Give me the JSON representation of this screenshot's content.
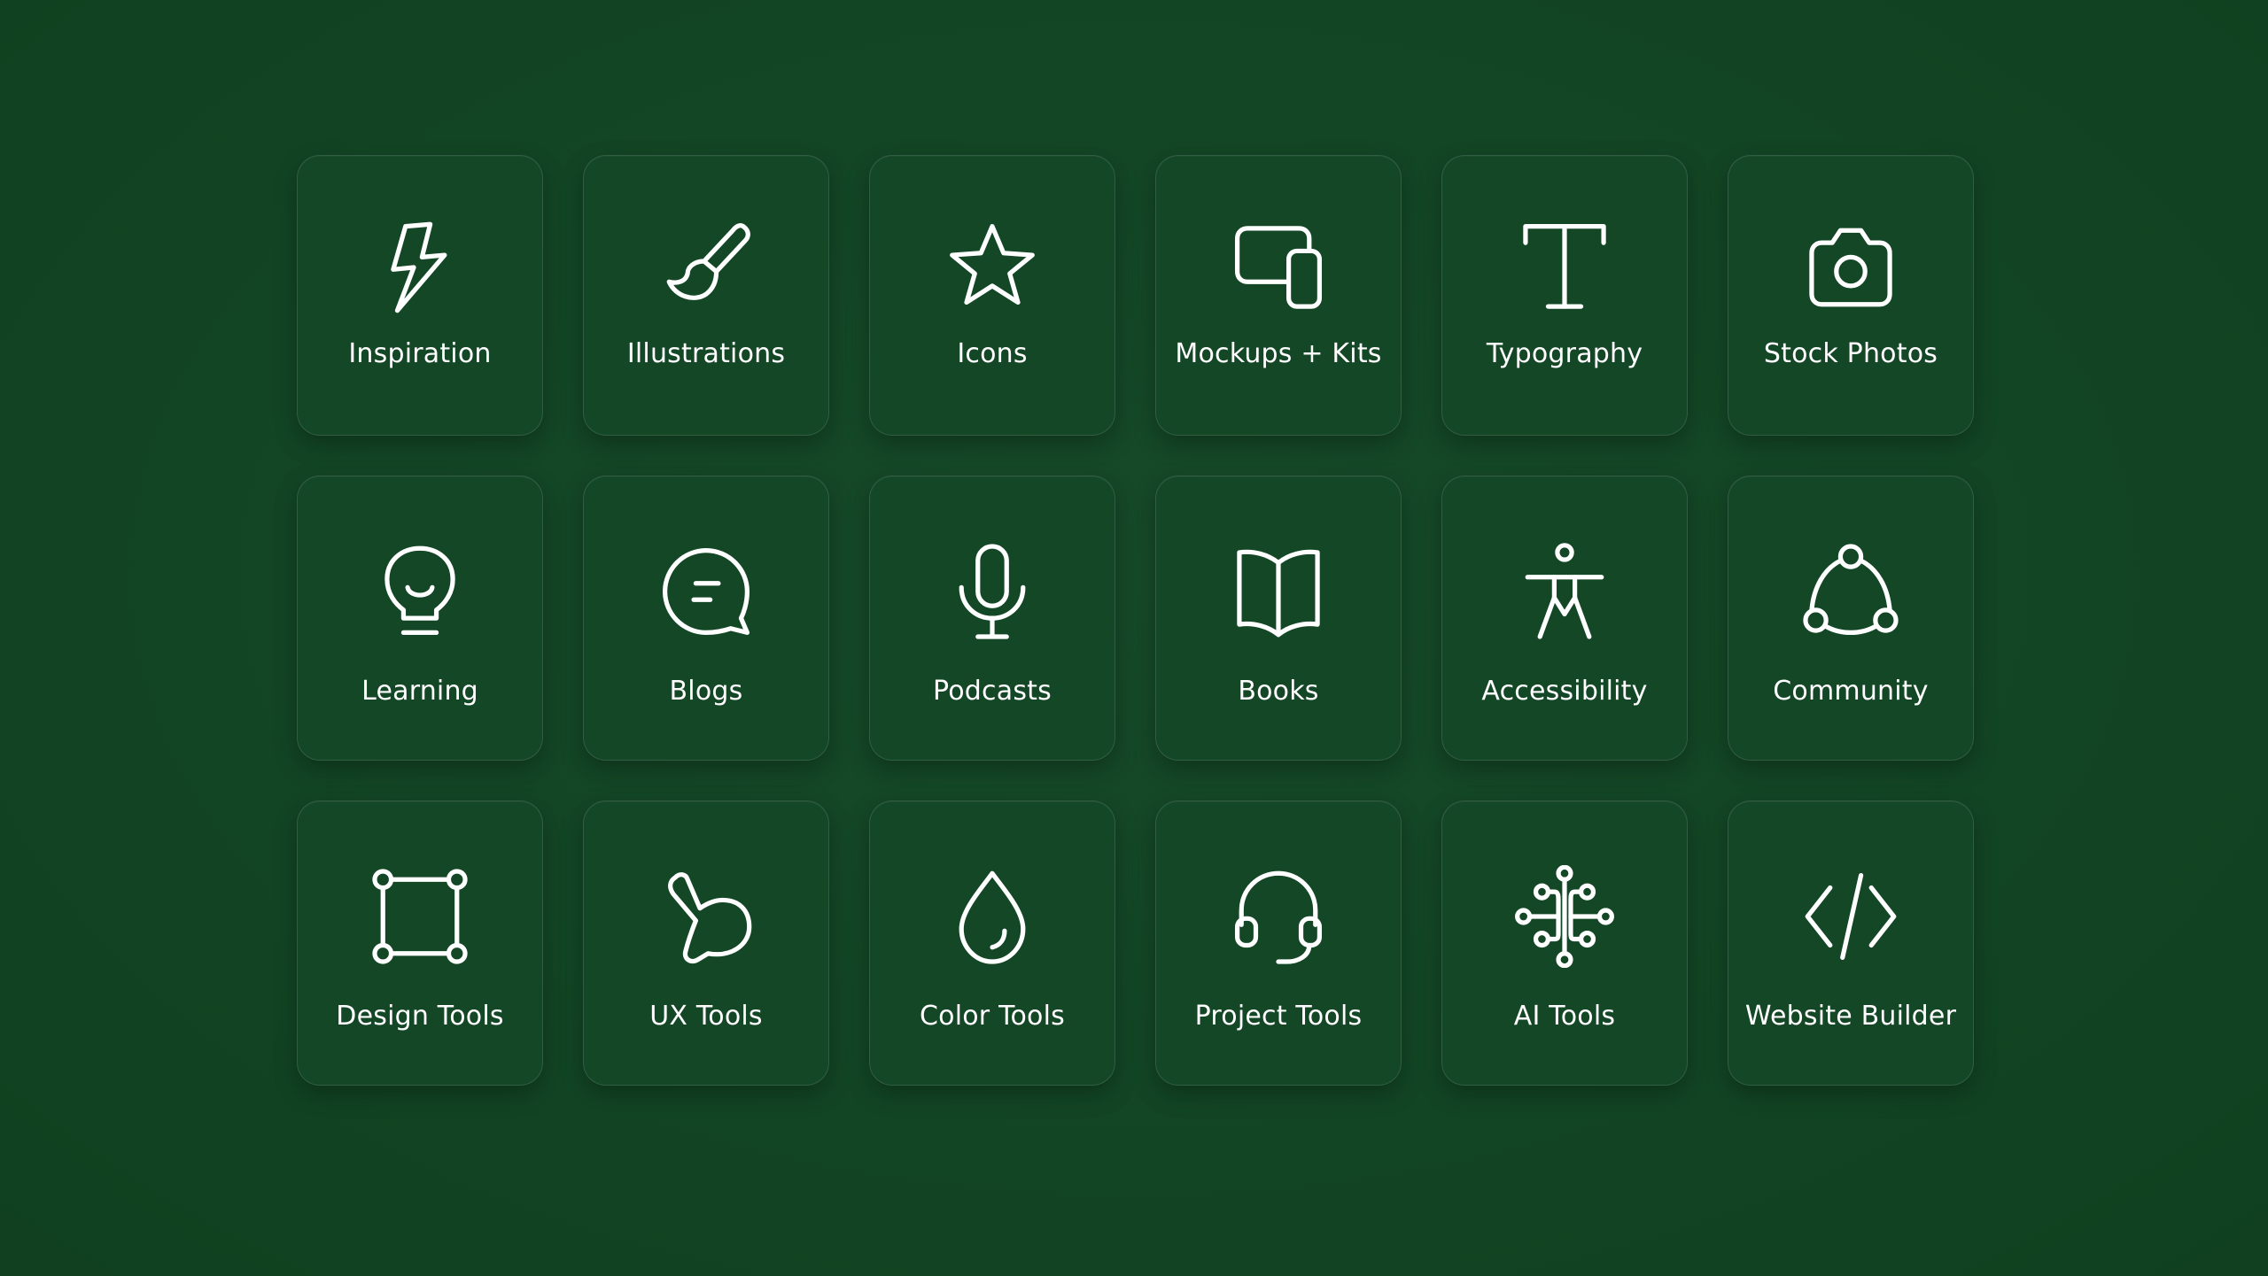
{
  "tiles": [
    {
      "label": "Inspiration",
      "icon": "lightning-bolt-icon"
    },
    {
      "label": "Illustrations",
      "icon": "paint-brush-icon"
    },
    {
      "label": "Icons",
      "icon": "star-icon"
    },
    {
      "label": "Mockups + Kits",
      "icon": "devices-icon"
    },
    {
      "label": "Typography",
      "icon": "letter-t-icon"
    },
    {
      "label": "Stock Photos",
      "icon": "camera-icon"
    },
    {
      "label": "Learning",
      "icon": "lightbulb-icon"
    },
    {
      "label": "Blogs",
      "icon": "chat-bubble-icon"
    },
    {
      "label": "Podcasts",
      "icon": "microphone-icon"
    },
    {
      "label": "Books",
      "icon": "open-book-icon"
    },
    {
      "label": "Accessibility",
      "icon": "accessibility-person-icon"
    },
    {
      "label": "Community",
      "icon": "community-nodes-icon"
    },
    {
      "label": "Design Tools",
      "icon": "vector-frame-icon"
    },
    {
      "label": "UX Tools",
      "icon": "pointer-hand-icon"
    },
    {
      "label": "Color Tools",
      "icon": "color-drop-icon"
    },
    {
      "label": "Project Tools",
      "icon": "headset-icon"
    },
    {
      "label": "AI Tools",
      "icon": "ai-circuit-icon"
    },
    {
      "label": "Website Builder",
      "icon": "code-brackets-icon"
    }
  ],
  "colors": {
    "background": "#124725",
    "tile": "#134726",
    "foreground": "#ffffff"
  }
}
